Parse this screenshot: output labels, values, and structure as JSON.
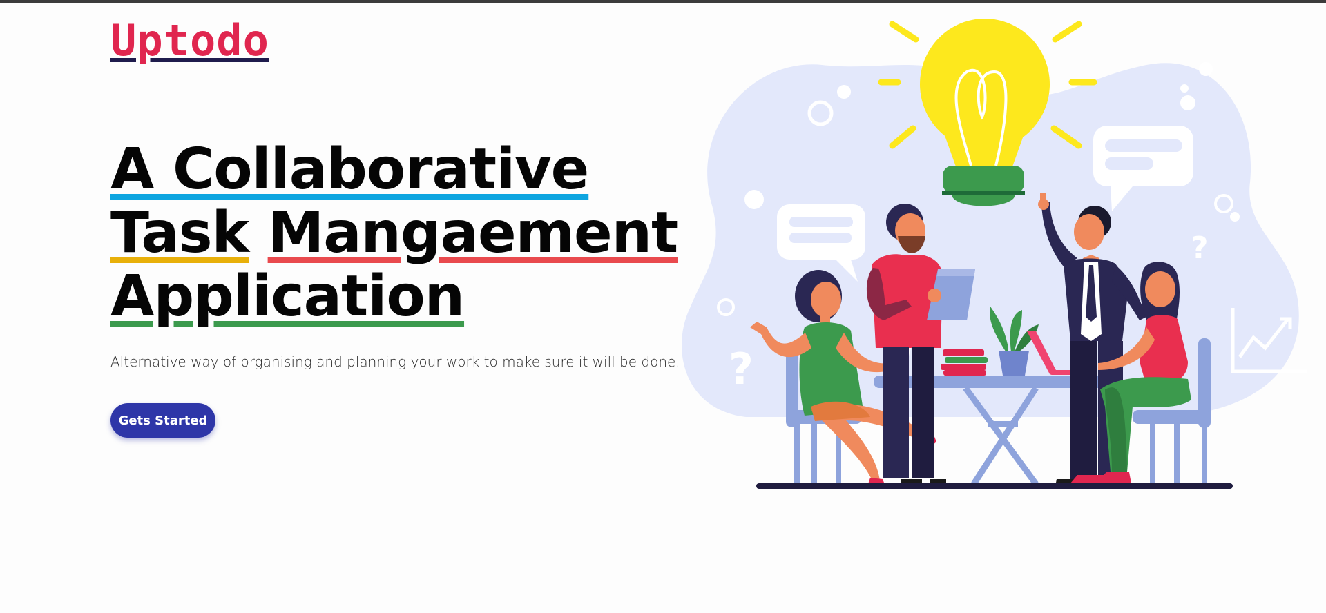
{
  "brand": {
    "logo_text": "Uptodo"
  },
  "hero": {
    "headline": {
      "line1": "A Collaborative",
      "line2_word1": "Task",
      "line2_word2": "Mangaement",
      "line3": "Application"
    },
    "subtitle": "Alternative way of organising and planning your work to make sure it will be done.",
    "cta_label": "Gets Started"
  },
  "illustration": {
    "icon": "team-brainstorm-illustration",
    "decor_text": [
      "?",
      "?"
    ]
  },
  "colors": {
    "logo": "#e0264f",
    "cta_bg": "#2e36a8",
    "underline_blue": "#0ea5e0",
    "underline_yellow": "#e8b00a",
    "underline_red": "#e94a4e",
    "underline_green": "#3c9a4d",
    "blob": "#e3e8fb",
    "bulb": "#fde81d"
  }
}
